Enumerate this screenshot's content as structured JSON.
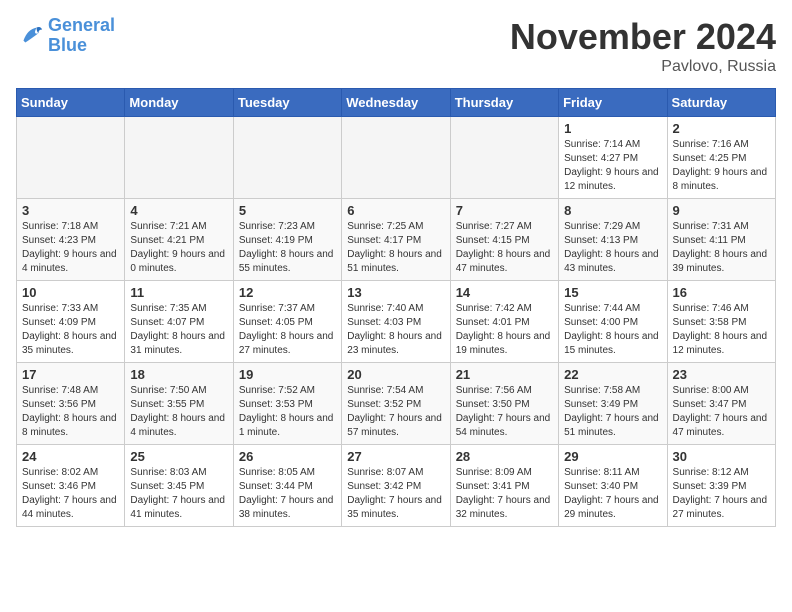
{
  "header": {
    "logo_line1": "General",
    "logo_line2": "Blue",
    "month": "November 2024",
    "location": "Pavlovo, Russia"
  },
  "weekdays": [
    "Sunday",
    "Monday",
    "Tuesday",
    "Wednesday",
    "Thursday",
    "Friday",
    "Saturday"
  ],
  "weeks": [
    [
      {
        "day": "",
        "info": ""
      },
      {
        "day": "",
        "info": ""
      },
      {
        "day": "",
        "info": ""
      },
      {
        "day": "",
        "info": ""
      },
      {
        "day": "",
        "info": ""
      },
      {
        "day": "1",
        "info": "Sunrise: 7:14 AM\nSunset: 4:27 PM\nDaylight: 9 hours and 12 minutes."
      },
      {
        "day": "2",
        "info": "Sunrise: 7:16 AM\nSunset: 4:25 PM\nDaylight: 9 hours and 8 minutes."
      }
    ],
    [
      {
        "day": "3",
        "info": "Sunrise: 7:18 AM\nSunset: 4:23 PM\nDaylight: 9 hours and 4 minutes."
      },
      {
        "day": "4",
        "info": "Sunrise: 7:21 AM\nSunset: 4:21 PM\nDaylight: 9 hours and 0 minutes."
      },
      {
        "day": "5",
        "info": "Sunrise: 7:23 AM\nSunset: 4:19 PM\nDaylight: 8 hours and 55 minutes."
      },
      {
        "day": "6",
        "info": "Sunrise: 7:25 AM\nSunset: 4:17 PM\nDaylight: 8 hours and 51 minutes."
      },
      {
        "day": "7",
        "info": "Sunrise: 7:27 AM\nSunset: 4:15 PM\nDaylight: 8 hours and 47 minutes."
      },
      {
        "day": "8",
        "info": "Sunrise: 7:29 AM\nSunset: 4:13 PM\nDaylight: 8 hours and 43 minutes."
      },
      {
        "day": "9",
        "info": "Sunrise: 7:31 AM\nSunset: 4:11 PM\nDaylight: 8 hours and 39 minutes."
      }
    ],
    [
      {
        "day": "10",
        "info": "Sunrise: 7:33 AM\nSunset: 4:09 PM\nDaylight: 8 hours and 35 minutes."
      },
      {
        "day": "11",
        "info": "Sunrise: 7:35 AM\nSunset: 4:07 PM\nDaylight: 8 hours and 31 minutes."
      },
      {
        "day": "12",
        "info": "Sunrise: 7:37 AM\nSunset: 4:05 PM\nDaylight: 8 hours and 27 minutes."
      },
      {
        "day": "13",
        "info": "Sunrise: 7:40 AM\nSunset: 4:03 PM\nDaylight: 8 hours and 23 minutes."
      },
      {
        "day": "14",
        "info": "Sunrise: 7:42 AM\nSunset: 4:01 PM\nDaylight: 8 hours and 19 minutes."
      },
      {
        "day": "15",
        "info": "Sunrise: 7:44 AM\nSunset: 4:00 PM\nDaylight: 8 hours and 15 minutes."
      },
      {
        "day": "16",
        "info": "Sunrise: 7:46 AM\nSunset: 3:58 PM\nDaylight: 8 hours and 12 minutes."
      }
    ],
    [
      {
        "day": "17",
        "info": "Sunrise: 7:48 AM\nSunset: 3:56 PM\nDaylight: 8 hours and 8 minutes."
      },
      {
        "day": "18",
        "info": "Sunrise: 7:50 AM\nSunset: 3:55 PM\nDaylight: 8 hours and 4 minutes."
      },
      {
        "day": "19",
        "info": "Sunrise: 7:52 AM\nSunset: 3:53 PM\nDaylight: 8 hours and 1 minute."
      },
      {
        "day": "20",
        "info": "Sunrise: 7:54 AM\nSunset: 3:52 PM\nDaylight: 7 hours and 57 minutes."
      },
      {
        "day": "21",
        "info": "Sunrise: 7:56 AM\nSunset: 3:50 PM\nDaylight: 7 hours and 54 minutes."
      },
      {
        "day": "22",
        "info": "Sunrise: 7:58 AM\nSunset: 3:49 PM\nDaylight: 7 hours and 51 minutes."
      },
      {
        "day": "23",
        "info": "Sunrise: 8:00 AM\nSunset: 3:47 PM\nDaylight: 7 hours and 47 minutes."
      }
    ],
    [
      {
        "day": "24",
        "info": "Sunrise: 8:02 AM\nSunset: 3:46 PM\nDaylight: 7 hours and 44 minutes."
      },
      {
        "day": "25",
        "info": "Sunrise: 8:03 AM\nSunset: 3:45 PM\nDaylight: 7 hours and 41 minutes."
      },
      {
        "day": "26",
        "info": "Sunrise: 8:05 AM\nSunset: 3:44 PM\nDaylight: 7 hours and 38 minutes."
      },
      {
        "day": "27",
        "info": "Sunrise: 8:07 AM\nSunset: 3:42 PM\nDaylight: 7 hours and 35 minutes."
      },
      {
        "day": "28",
        "info": "Sunrise: 8:09 AM\nSunset: 3:41 PM\nDaylight: 7 hours and 32 minutes."
      },
      {
        "day": "29",
        "info": "Sunrise: 8:11 AM\nSunset: 3:40 PM\nDaylight: 7 hours and 29 minutes."
      },
      {
        "day": "30",
        "info": "Sunrise: 8:12 AM\nSunset: 3:39 PM\nDaylight: 7 hours and 27 minutes."
      }
    ]
  ]
}
